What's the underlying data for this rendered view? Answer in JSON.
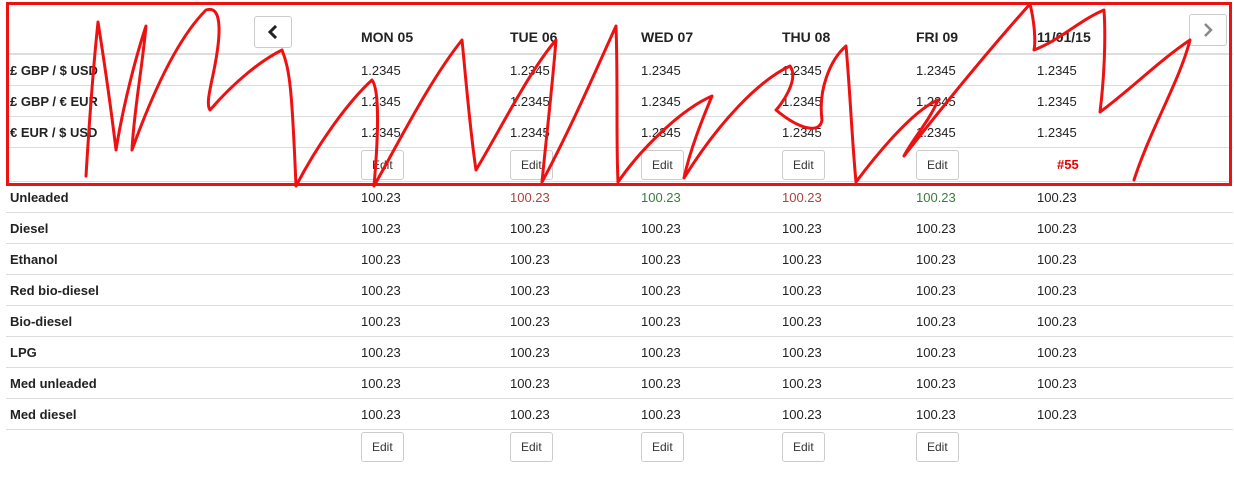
{
  "header": {
    "days": [
      "MON 05",
      "TUE 06",
      "WED 07",
      "THU 08",
      "FRI 09",
      "11/01/15"
    ]
  },
  "currency_rows": [
    {
      "label": "£ GBP / $ USD",
      "values": [
        "1.2345",
        "1.2345",
        "1.2345",
        "1.2345",
        "1.2345",
        "1.2345"
      ]
    },
    {
      "label": "£ GBP / € EUR",
      "values": [
        "1.2345",
        "1.2345",
        "1.2345",
        "1.2345",
        "1.2345",
        "1.2345"
      ]
    },
    {
      "label": "€ EUR / $ USD",
      "values": [
        "1.2345",
        "1.2345",
        "1.2345",
        "1.2345",
        "1.2345",
        "1.2345"
      ]
    }
  ],
  "currency_edit": {
    "labels": [
      "Edit",
      "Edit",
      "Edit",
      "Edit",
      "Edit"
    ],
    "ticket": "#55"
  },
  "fuel_rows": [
    {
      "label": "Unleaded",
      "values": [
        "100.23",
        "100.23",
        "100.23",
        "100.23",
        "100.23",
        "100.23"
      ]
    },
    {
      "label": "Diesel",
      "values": [
        "100.23",
        "100.23",
        "100.23",
        "100.23",
        "100.23",
        "100.23"
      ]
    },
    {
      "label": "Ethanol",
      "values": [
        "100.23",
        "100.23",
        "100.23",
        "100.23",
        "100.23",
        "100.23"
      ]
    },
    {
      "label": "Red bio-diesel",
      "values": [
        "100.23",
        "100.23",
        "100.23",
        "100.23",
        "100.23",
        "100.23"
      ]
    },
    {
      "label": "Bio-diesel",
      "values": [
        "100.23",
        "100.23",
        "100.23",
        "100.23",
        "100.23",
        "100.23"
      ]
    },
    {
      "label": "LPG",
      "values": [
        "100.23",
        "100.23",
        "100.23",
        "100.23",
        "100.23",
        "100.23"
      ]
    },
    {
      "label": "Med unleaded",
      "values": [
        "100.23",
        "100.23",
        "100.23",
        "100.23",
        "100.23",
        "100.23"
      ]
    },
    {
      "label": "Med diesel",
      "values": [
        "100.23",
        "100.23",
        "100.23",
        "100.23",
        "100.23",
        "100.23"
      ]
    }
  ],
  "fuel_edit": {
    "labels": [
      "Edit",
      "Edit",
      "Edit",
      "Edit",
      "Edit"
    ]
  },
  "nav": {
    "prev_icon": "chevron-left-icon",
    "next_icon": "chevron-right-icon"
  },
  "colors": {
    "price_up": "#3a7d3a",
    "price_down": "#a94442",
    "annotation": "#ee1111"
  }
}
